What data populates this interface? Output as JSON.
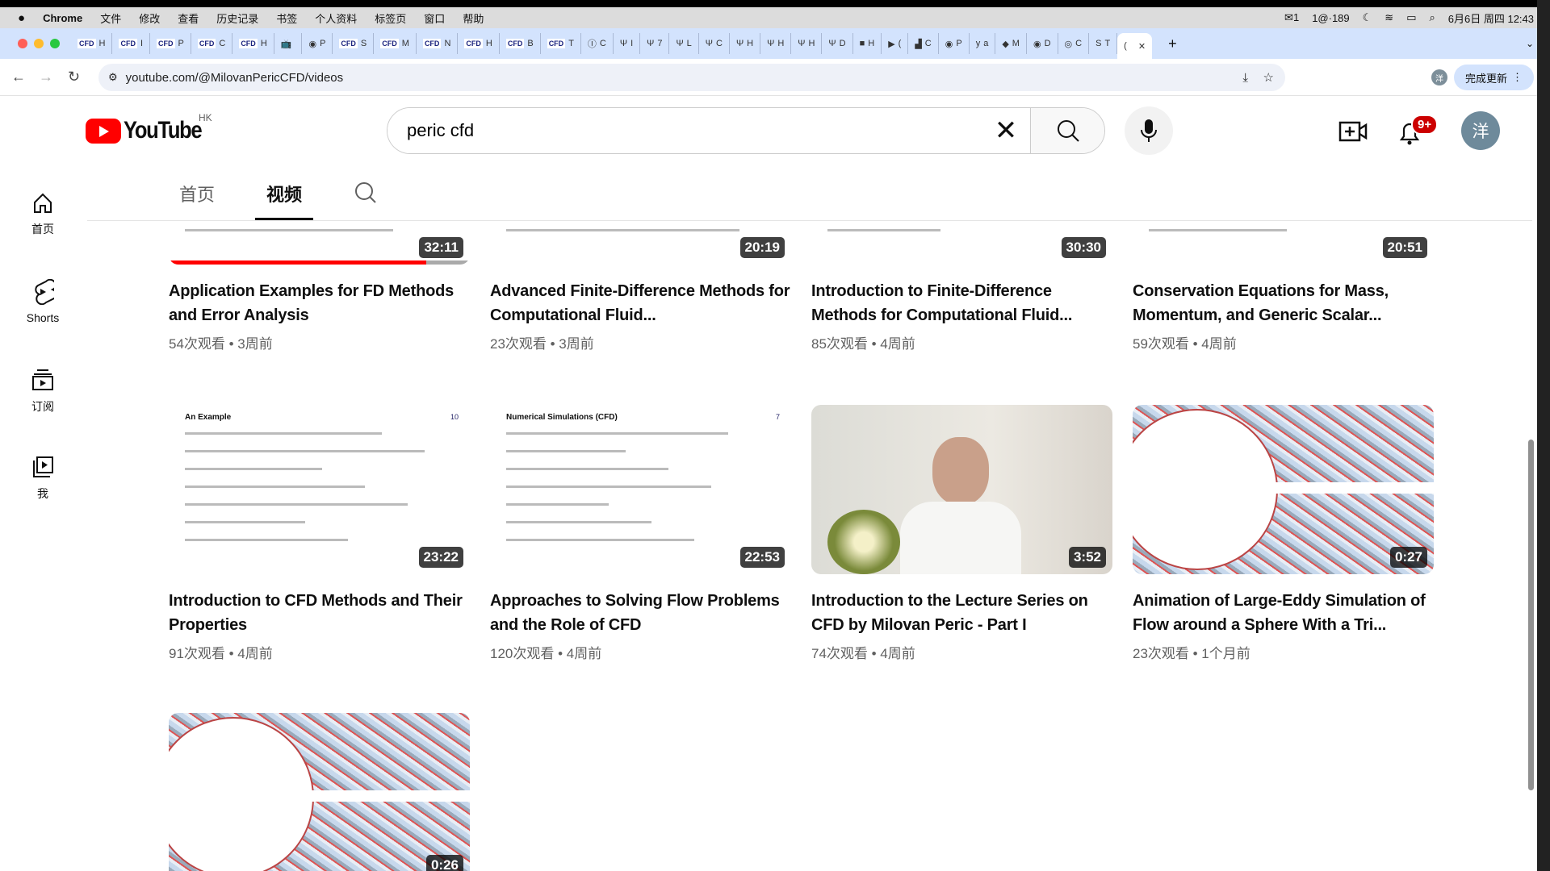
{
  "menubar": {
    "app": "Chrome",
    "items": [
      "文件",
      "修改",
      "查看",
      "历史记录",
      "书签",
      "个人资料",
      "标签页",
      "窗口",
      "帮助"
    ],
    "status": {
      "wechat_count": "1",
      "vpn": "1@·189",
      "datetime": "6月6日 周四 12:43"
    }
  },
  "browser": {
    "tabs": [
      {
        "icon": "CFD",
        "label": "H"
      },
      {
        "icon": "CFD",
        "label": "I"
      },
      {
        "icon": "CFD",
        "label": "P"
      },
      {
        "icon": "CFD",
        "label": "C"
      },
      {
        "icon": "CFD",
        "label": "H"
      },
      {
        "icon": "📺",
        "label": ""
      },
      {
        "icon": "◉",
        "label": "P"
      },
      {
        "icon": "CFD",
        "label": "S"
      },
      {
        "icon": "CFD",
        "label": "M"
      },
      {
        "icon": "CFD",
        "label": "N"
      },
      {
        "icon": "CFD",
        "label": "H"
      },
      {
        "icon": "CFD",
        "label": "B"
      },
      {
        "icon": "CFD",
        "label": "T"
      },
      {
        "icon": "Ⓘ",
        "label": "C"
      },
      {
        "icon": "Ψ",
        "label": "I"
      },
      {
        "icon": "Ψ",
        "label": "7"
      },
      {
        "icon": "Ψ",
        "label": "L"
      },
      {
        "icon": "Ψ",
        "label": "C"
      },
      {
        "icon": "Ψ",
        "label": "H"
      },
      {
        "icon": "Ψ",
        "label": "H"
      },
      {
        "icon": "Ψ",
        "label": "H"
      },
      {
        "icon": "Ψ",
        "label": "D"
      },
      {
        "icon": "■",
        "label": "H"
      },
      {
        "icon": "▶",
        "label": "("
      },
      {
        "icon": "▟",
        "label": "C"
      },
      {
        "icon": "◉",
        "label": "P"
      },
      {
        "icon": "y",
        "label": "a"
      },
      {
        "icon": "◆",
        "label": "M"
      },
      {
        "icon": "◉",
        "label": "D"
      },
      {
        "icon": "◎",
        "label": "C"
      },
      {
        "icon": "S",
        "label": "T"
      }
    ],
    "active_tab": {
      "label": "(",
      "close": "✕"
    },
    "new_tab": "+",
    "url": "youtube.com/@MilovanPericCFD/videos",
    "profile": "洋",
    "update_label": "完成更新"
  },
  "youtube": {
    "logo_text": "YouTube",
    "region": "HK",
    "search": {
      "value": "peric cfd"
    },
    "notifications": "9+",
    "avatar": "洋",
    "channel_tabs": [
      {
        "label": "首页"
      },
      {
        "label": "视频",
        "selected": true
      }
    ],
    "sidebar": [
      {
        "label": "首页",
        "icon": "home-icon"
      },
      {
        "label": "Shorts",
        "icon": "shorts-icon"
      },
      {
        "label": "订阅",
        "icon": "subscriptions-icon"
      },
      {
        "label": "我",
        "icon": "you-icon"
      }
    ],
    "videos": [
      {
        "title": "Application Examples for FD Methods and Error Analysis",
        "meta": "54次观看 • 3周前",
        "duration": "32:11",
        "watched": 0.855,
        "thumb": "slide"
      },
      {
        "title": "Advanced Finite-Difference Methods for Computational Fluid...",
        "meta": "23次观看 • 3周前",
        "duration": "20:19",
        "thumb": "slide"
      },
      {
        "title": "Introduction to Finite-Difference Methods for Computational Fluid...",
        "meta": "85次观看 • 4周前",
        "duration": "30:30",
        "thumb": "slide"
      },
      {
        "title": "Conservation Equations for Mass, Momentum, and Generic Scalar...",
        "meta": "59次观看 • 4周前",
        "duration": "20:51",
        "thumb": "slide"
      },
      {
        "title": "Introduction to CFD Methods and Their Properties",
        "meta": "91次观看 • 4周前",
        "duration": "23:22",
        "thumb": "slide",
        "slide_heading": "An Example",
        "slide_page": "10"
      },
      {
        "title": "Approaches to Solving Flow Problems and the Role of CFD",
        "meta": "120次观看 • 4周前",
        "duration": "22:53",
        "thumb": "slide",
        "slide_heading": "Numerical Simulations (CFD)",
        "slide_page": "7"
      },
      {
        "title": "Introduction to the Lecture Series on CFD by Milovan Peric - Part I",
        "meta": "74次观看 • 4周前",
        "duration": "3:52",
        "thumb": "photo"
      },
      {
        "title": "Animation of Large-Eddy Simulation of Flow around a Sphere With a Tri...",
        "meta": "23次观看 • 1个月前",
        "duration": "0:27",
        "thumb": "sim"
      },
      {
        "title": "",
        "meta": "",
        "duration": "0:26",
        "thumb": "sim"
      }
    ]
  }
}
